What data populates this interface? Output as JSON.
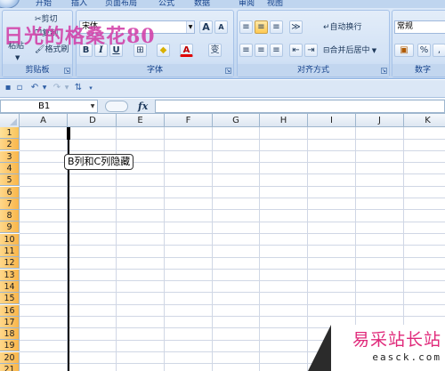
{
  "tabs": [
    "开始",
    "插入",
    "页面布局",
    "公式",
    "数据",
    "审阅",
    "视图"
  ],
  "watermark": "日光的格桑花80",
  "clipboard": {
    "cut": "剪切",
    "copy": "复制",
    "paste": "粘贴",
    "format_painter": "格式刷",
    "group_label": "剪贴板"
  },
  "font": {
    "font_name": "宋体",
    "group_label": "字体",
    "bold": "B",
    "italic": "I",
    "underline": "U",
    "grow": "A",
    "shrink": "A",
    "pinyin": "变"
  },
  "alignment": {
    "wrap_text": "自动换行",
    "merge_center": "合并后居中",
    "group_label": "对齐方式"
  },
  "number": {
    "format": "常规",
    "group_label": "数字",
    "percent": "%",
    "comma": ","
  },
  "formula_bar": {
    "name_box": "B1",
    "fx": "fx",
    "content": ""
  },
  "columns": [
    "A",
    "D",
    "E",
    "F",
    "G",
    "H",
    "I",
    "J",
    "K"
  ],
  "rows": [
    "1",
    "2",
    "3",
    "4",
    "5",
    "6",
    "7",
    "8",
    "9",
    "10",
    "11",
    "12",
    "13",
    "14",
    "15",
    "16",
    "17",
    "18",
    "19",
    "20",
    "21"
  ],
  "callout": "B列和C列隐藏",
  "footer": {
    "title": "易采站长站",
    "url": "easck.com"
  },
  "colors": {
    "ribbon_bg": "#c5d9f1",
    "row_header_selected": "#f9b64a",
    "gridline": "#d0d7e5",
    "watermark": "#d23ea8",
    "footer_title": "#e0297a"
  }
}
